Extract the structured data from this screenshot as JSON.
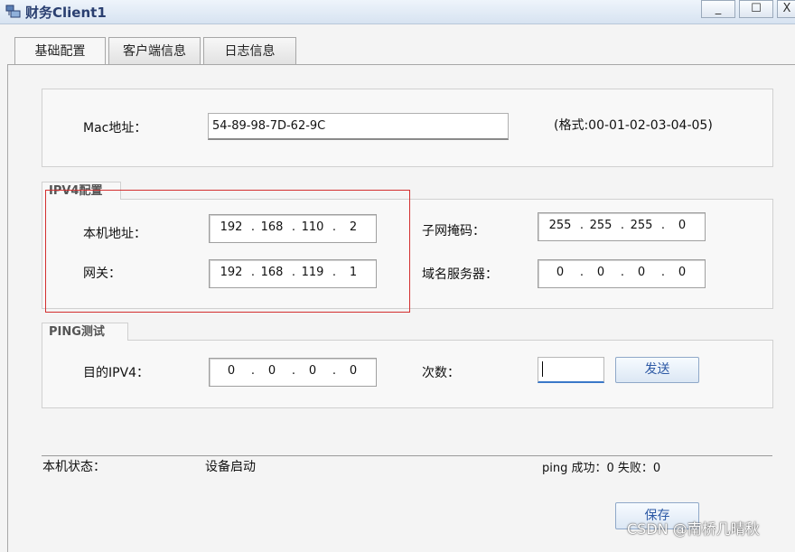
{
  "window": {
    "title": "财务Client1",
    "controls": [
      "_",
      "☐",
      "X"
    ]
  },
  "tabs": [
    "基础配置",
    "客户端信息",
    "日志信息"
  ],
  "mac": {
    "label": "Mac地址：",
    "value": "54-89-98-7D-62-9C",
    "format_hint": "(格式:00-01-02-03-04-05)"
  },
  "ipv4": {
    "group_title": "IPV4配置",
    "host_label": "本机地址：",
    "host_ip": [
      "192",
      "168",
      "110",
      "2"
    ],
    "subnet_label": "子网掩码：",
    "subnet": [
      "255",
      "255",
      "255",
      "0"
    ],
    "gateway_label": "网关：",
    "gateway_ip": [
      "192",
      "168",
      "119",
      "1"
    ],
    "dns_label": "域名服务器：",
    "dns": [
      "0",
      "0",
      "0",
      "0"
    ]
  },
  "ping": {
    "group_title": "PING测试",
    "target_label": "目的IPV4：",
    "target_ip": [
      "0",
      "0",
      "0",
      "0"
    ],
    "count_label": "次数：",
    "count_value": "",
    "send_label": "发送"
  },
  "status": {
    "label": "本机状态：",
    "value": "设备启动",
    "ping_result": "ping 成功：0 失败：0"
  },
  "save_label": "保存",
  "watermark": "CSDN @南桥几晴秋",
  "colors": {
    "highlight_border": "#d32f2f",
    "button_text": "#2d59a5"
  }
}
